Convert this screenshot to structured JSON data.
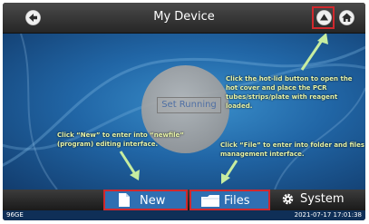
{
  "header": {
    "title": "My Device",
    "back_icon": "arrow-left-icon",
    "lid_icon": "eject-triangle-icon",
    "home_icon": "home-icon"
  },
  "main": {
    "run_button_label": "Set Running",
    "hints": {
      "lid": "Click the hot-lid button to open the hot cover and place the PCR tubes/strips/plate with reagent loaded.",
      "new": "Click “New” to enter into “newfile” (program) editing interface.",
      "files": "Click “File” to enter into folder and files management interface."
    }
  },
  "bottom_tabs": {
    "new_label": "New",
    "files_label": "Files",
    "system_label": "System"
  },
  "status": {
    "model": "96GE",
    "datetime": "2021-07-17  17:01:38"
  },
  "colors": {
    "highlight": "#d0282d",
    "tab_blue": "#2f6fb2",
    "hint_text": "#e8f4a8",
    "arrow": "#c7eda0"
  }
}
